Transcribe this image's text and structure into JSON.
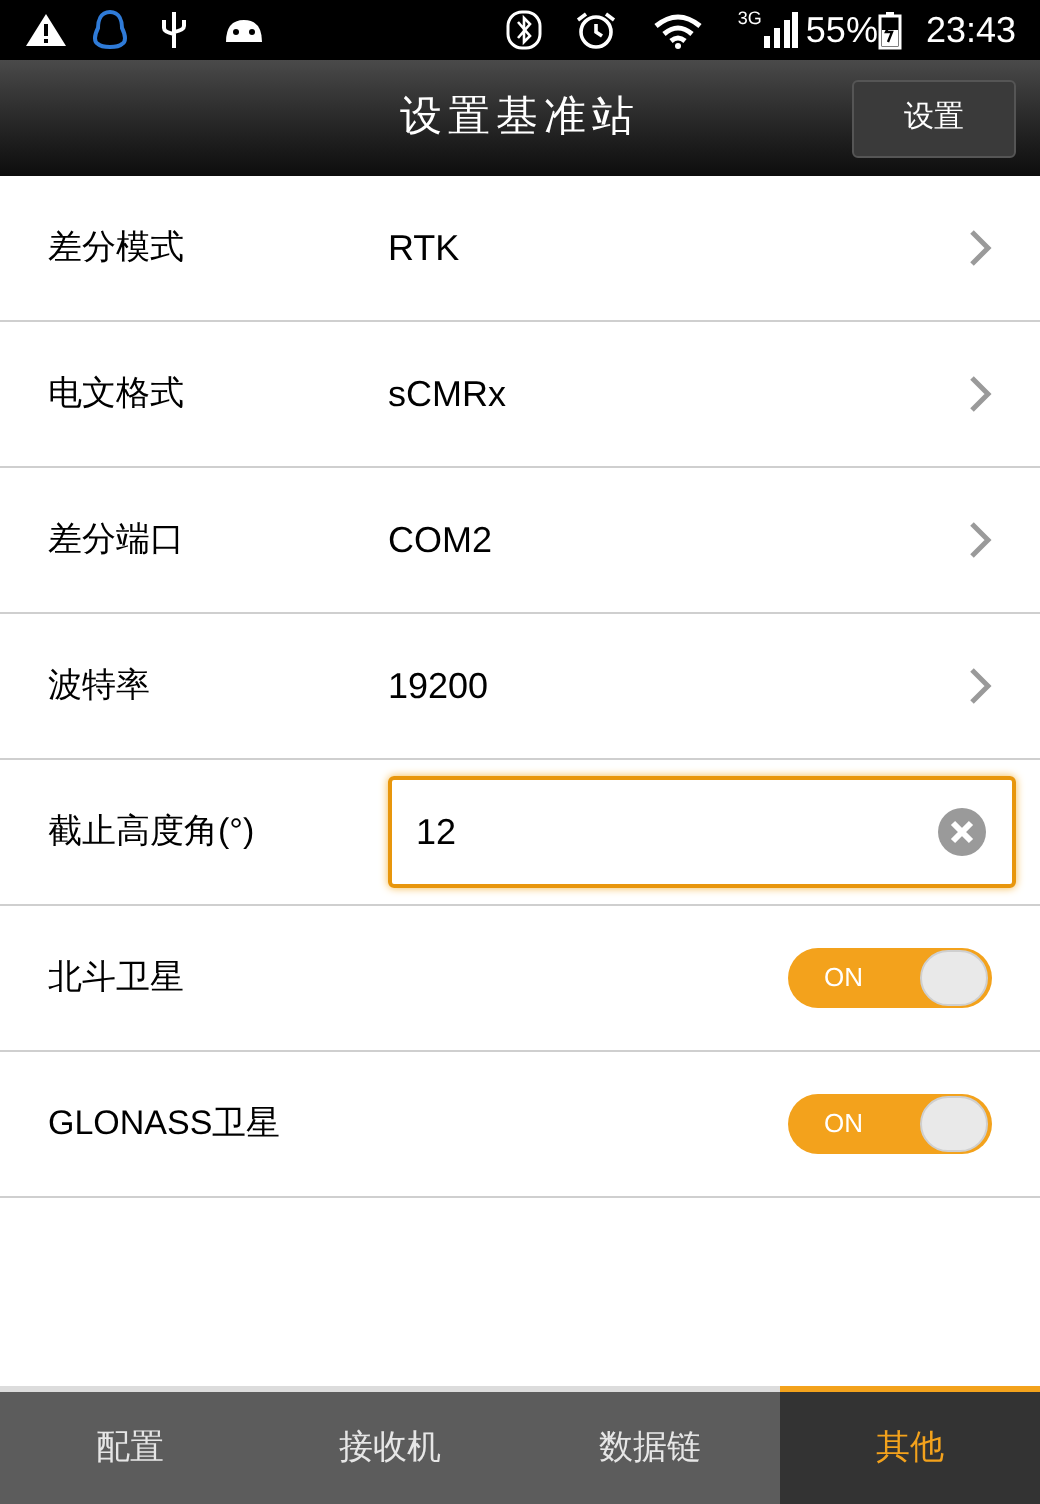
{
  "status_bar": {
    "network": "3G",
    "battery": "55%",
    "time": "23:43"
  },
  "header": {
    "title": "设置基准站",
    "button": "设置"
  },
  "rows": [
    {
      "kind": "select",
      "label": "差分模式",
      "value": "RTK"
    },
    {
      "kind": "select",
      "label": "电文格式",
      "value": "sCMRx"
    },
    {
      "kind": "select",
      "label": "差分端口",
      "value": "COM2"
    },
    {
      "kind": "select",
      "label": "波特率",
      "value": "19200"
    },
    {
      "kind": "input",
      "label": "截止高度角(°)",
      "value": "12",
      "focused": true
    },
    {
      "kind": "toggle",
      "label": "北斗卫星",
      "on": true,
      "toggle_text": "ON"
    },
    {
      "kind": "toggle",
      "label": "GLONASS卫星",
      "on": true,
      "toggle_text": "ON"
    }
  ],
  "tabs": [
    {
      "label": "配置",
      "selected": false
    },
    {
      "label": "接收机",
      "selected": false
    },
    {
      "label": "数据链",
      "selected": false
    },
    {
      "label": "其他",
      "selected": true
    }
  ]
}
